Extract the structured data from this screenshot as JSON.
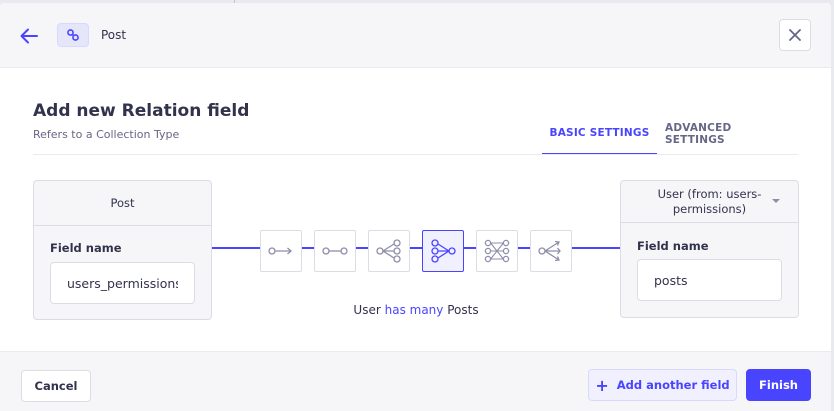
{
  "header": {
    "breadcrumb": "Post",
    "icons": {
      "back": "arrow-left-icon",
      "crumb": "link-icon",
      "close": "close-icon"
    }
  },
  "form": {
    "title": "Add new Relation field",
    "subtitle": "Refers to a Collection Type"
  },
  "tabs": [
    {
      "label": "BASIC SETTINGS",
      "active": true
    },
    {
      "label": "ADVANCED SETTINGS",
      "active": false
    }
  ],
  "left_card": {
    "title": "Post",
    "field_label": "Field name",
    "field_value": "users_permissions"
  },
  "right_card": {
    "title": "User (from: users-permissions)",
    "field_label": "Field name",
    "field_value": "posts"
  },
  "relations": [
    {
      "name": "one-way",
      "active": false
    },
    {
      "name": "one-to-one",
      "active": false
    },
    {
      "name": "one-to-many",
      "active": false
    },
    {
      "name": "many-to-one",
      "active": true
    },
    {
      "name": "many-to-many",
      "active": false
    },
    {
      "name": "many-way",
      "active": false
    }
  ],
  "caption": {
    "subject": "User",
    "verb": "has many",
    "object": "Posts"
  },
  "footer": {
    "cancel_label": "Cancel",
    "add_label": "Add another field",
    "finish_label": "Finish"
  },
  "colors": {
    "accent": "#4945ff",
    "accent_light": "#f0f0ff",
    "neutral_bg": "#f6f6f9",
    "border": "#dcdce4"
  }
}
